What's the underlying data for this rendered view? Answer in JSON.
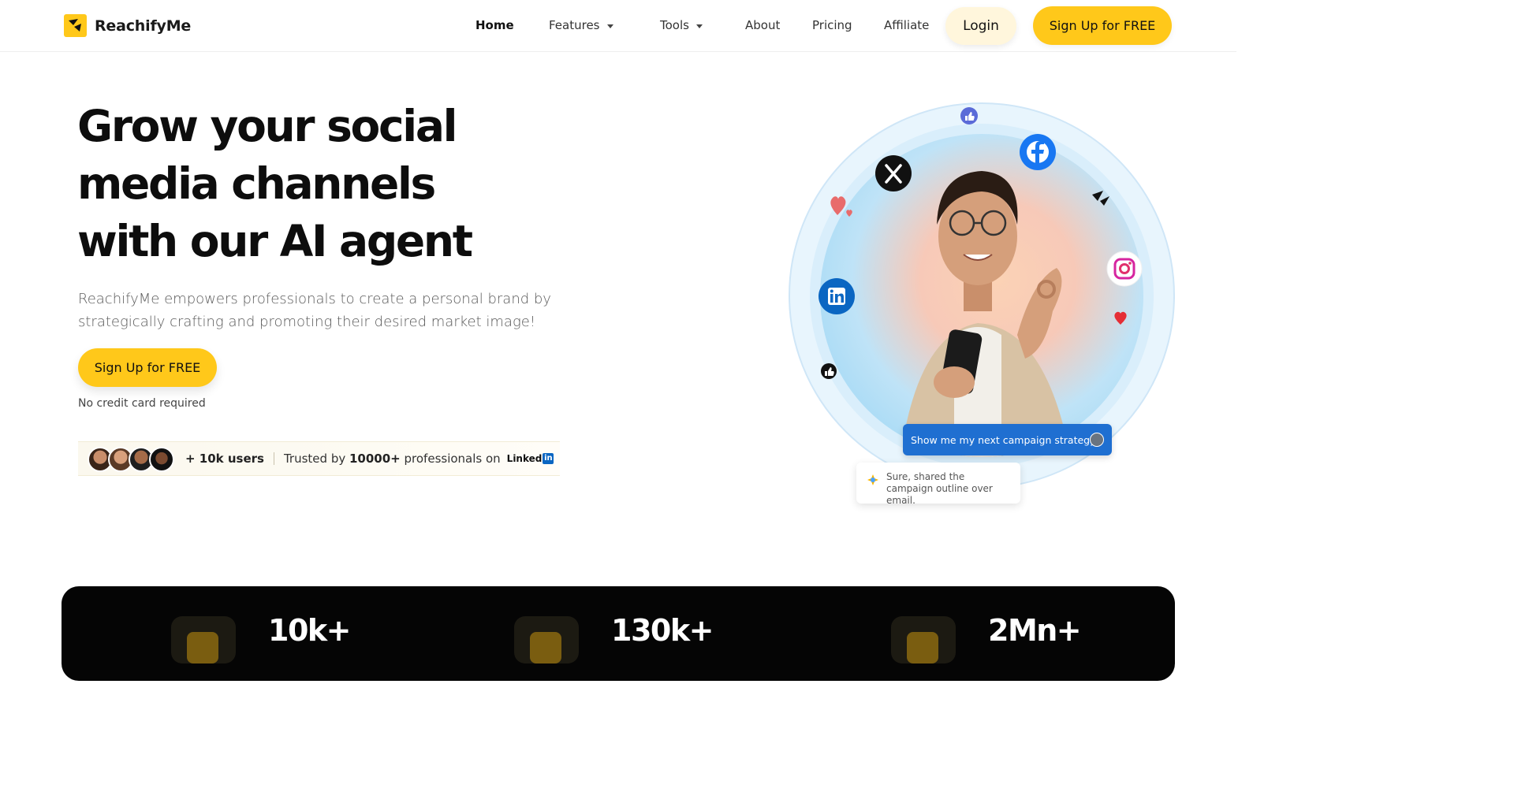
{
  "brand": {
    "name": "ReachifyMe",
    "accent": "#ffc81a",
    "dark": "#050505"
  },
  "nav": {
    "items": [
      {
        "label": "Home",
        "active": true
      },
      {
        "label": "Features",
        "dropdown": true
      },
      {
        "label": "Tools",
        "dropdown": true
      },
      {
        "label": "About"
      },
      {
        "label": "Pricing"
      },
      {
        "label": "Affiliate"
      }
    ],
    "login_label": "Login",
    "signup_label": "Sign Up for FREE"
  },
  "hero": {
    "title_lines": [
      "Grow your social",
      "media channels",
      "with our AI agent"
    ],
    "subtitle": "ReachifyMe empowers professionals to create a personal brand by strategically crafting and promoting their desired market image!",
    "cta_label": "Sign Up for FREE",
    "note": "No credit card required",
    "trust": {
      "users": "+ 10k users",
      "text_prefix": "Trusted by ",
      "text_bold": "10000+",
      "text_suffix": " professionals on",
      "linkedin_word": "Linked",
      "linkedin_box": "in"
    }
  },
  "illustration": {
    "icons": [
      "x-logo-icon",
      "facebook-icon",
      "instagram-icon",
      "linkedin-icon",
      "thumbs-up-icon",
      "heart-icon"
    ],
    "chat_user": "Show me my next campaign strategy",
    "chat_reply": "Sure, shared the campaign outline over email."
  },
  "stats": [
    {
      "value": "10k+"
    },
    {
      "value": "130k+"
    },
    {
      "value": "2Mn+"
    }
  ]
}
